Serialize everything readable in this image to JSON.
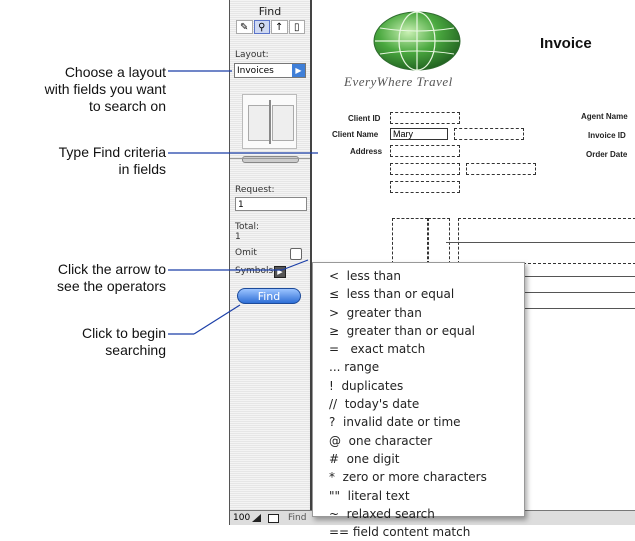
{
  "callouts": [
    {
      "lines": [
        "Choose a layout",
        "with fields you want",
        "to search on"
      ]
    },
    {
      "lines": [
        "Type Find criteria",
        "in fields"
      ]
    },
    {
      "lines": [
        "Click the arrow to",
        "see the operators"
      ]
    },
    {
      "lines": [
        "Click to begin",
        "searching"
      ]
    }
  ],
  "status_area": {
    "title": "Find",
    "tool_icons": [
      "pencil-icon",
      "find-icon",
      "pointer-icon",
      "layout-icon"
    ],
    "layout_label": "Layout:",
    "layout_value": "Invoices",
    "request_label": "Request:",
    "request_value": "1",
    "total_label": "Total:",
    "total_value": "1",
    "omit_label": "Omit",
    "symbols_label": "Symbols",
    "find_button": "Find",
    "zoom": "100",
    "mode": "Find"
  },
  "form": {
    "brand": "EveryWhere Travel",
    "title": "Invoice",
    "client_id_label": "Client ID",
    "client_name_label": "Client Name",
    "client_name_value": "Mary",
    "address_label": "Address",
    "agent_name_label": "Agent Name",
    "invoice_id_label": "Invoice ID",
    "order_date_label": "Order Date"
  },
  "symbols_menu": [
    "<  less than",
    "≤  less than or equal",
    ">  greater than",
    "≥  greater than or equal",
    "=   exact match",
    "... range",
    "!  duplicates",
    "//  today's date",
    "?  invalid date or time",
    "@  one character",
    "#  one digit",
    "*  zero or more characters",
    "\"\"  literal text",
    "~  relaxed search",
    "== field content match"
  ],
  "colors": {
    "callout_line": "#1b3fa8",
    "find_button": "#2e6fd6",
    "globe": "#3a9a3a"
  }
}
